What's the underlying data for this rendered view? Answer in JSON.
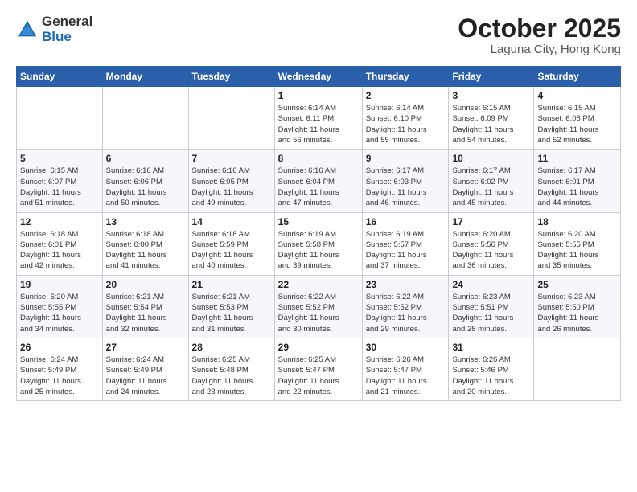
{
  "header": {
    "logo_general": "General",
    "logo_blue": "Blue",
    "month_title": "October 2025",
    "subtitle": "Laguna City, Hong Kong"
  },
  "days_of_week": [
    "Sunday",
    "Monday",
    "Tuesday",
    "Wednesday",
    "Thursday",
    "Friday",
    "Saturday"
  ],
  "weeks": [
    [
      {
        "day": "",
        "info": ""
      },
      {
        "day": "",
        "info": ""
      },
      {
        "day": "",
        "info": ""
      },
      {
        "day": "1",
        "info": "Sunrise: 6:14 AM\nSunset: 6:11 PM\nDaylight: 11 hours\nand 56 minutes."
      },
      {
        "day": "2",
        "info": "Sunrise: 6:14 AM\nSunset: 6:10 PM\nDaylight: 11 hours\nand 55 minutes."
      },
      {
        "day": "3",
        "info": "Sunrise: 6:15 AM\nSunset: 6:09 PM\nDaylight: 11 hours\nand 54 minutes."
      },
      {
        "day": "4",
        "info": "Sunrise: 6:15 AM\nSunset: 6:08 PM\nDaylight: 11 hours\nand 52 minutes."
      }
    ],
    [
      {
        "day": "5",
        "info": "Sunrise: 6:15 AM\nSunset: 6:07 PM\nDaylight: 11 hours\nand 51 minutes."
      },
      {
        "day": "6",
        "info": "Sunrise: 6:16 AM\nSunset: 6:06 PM\nDaylight: 11 hours\nand 50 minutes."
      },
      {
        "day": "7",
        "info": "Sunrise: 6:16 AM\nSunset: 6:05 PM\nDaylight: 11 hours\nand 49 minutes."
      },
      {
        "day": "8",
        "info": "Sunrise: 6:16 AM\nSunset: 6:04 PM\nDaylight: 11 hours\nand 47 minutes."
      },
      {
        "day": "9",
        "info": "Sunrise: 6:17 AM\nSunset: 6:03 PM\nDaylight: 11 hours\nand 46 minutes."
      },
      {
        "day": "10",
        "info": "Sunrise: 6:17 AM\nSunset: 6:02 PM\nDaylight: 11 hours\nand 45 minutes."
      },
      {
        "day": "11",
        "info": "Sunrise: 6:17 AM\nSunset: 6:01 PM\nDaylight: 11 hours\nand 44 minutes."
      }
    ],
    [
      {
        "day": "12",
        "info": "Sunrise: 6:18 AM\nSunset: 6:01 PM\nDaylight: 11 hours\nand 42 minutes."
      },
      {
        "day": "13",
        "info": "Sunrise: 6:18 AM\nSunset: 6:00 PM\nDaylight: 11 hours\nand 41 minutes."
      },
      {
        "day": "14",
        "info": "Sunrise: 6:18 AM\nSunset: 5:59 PM\nDaylight: 11 hours\nand 40 minutes."
      },
      {
        "day": "15",
        "info": "Sunrise: 6:19 AM\nSunset: 5:58 PM\nDaylight: 11 hours\nand 39 minutes."
      },
      {
        "day": "16",
        "info": "Sunrise: 6:19 AM\nSunset: 5:57 PM\nDaylight: 11 hours\nand 37 minutes."
      },
      {
        "day": "17",
        "info": "Sunrise: 6:20 AM\nSunset: 5:56 PM\nDaylight: 11 hours\nand 36 minutes."
      },
      {
        "day": "18",
        "info": "Sunrise: 6:20 AM\nSunset: 5:55 PM\nDaylight: 11 hours\nand 35 minutes."
      }
    ],
    [
      {
        "day": "19",
        "info": "Sunrise: 6:20 AM\nSunset: 5:55 PM\nDaylight: 11 hours\nand 34 minutes."
      },
      {
        "day": "20",
        "info": "Sunrise: 6:21 AM\nSunset: 5:54 PM\nDaylight: 11 hours\nand 32 minutes."
      },
      {
        "day": "21",
        "info": "Sunrise: 6:21 AM\nSunset: 5:53 PM\nDaylight: 11 hours\nand 31 minutes."
      },
      {
        "day": "22",
        "info": "Sunrise: 6:22 AM\nSunset: 5:52 PM\nDaylight: 11 hours\nand 30 minutes."
      },
      {
        "day": "23",
        "info": "Sunrise: 6:22 AM\nSunset: 5:52 PM\nDaylight: 11 hours\nand 29 minutes."
      },
      {
        "day": "24",
        "info": "Sunrise: 6:23 AM\nSunset: 5:51 PM\nDaylight: 11 hours\nand 28 minutes."
      },
      {
        "day": "25",
        "info": "Sunrise: 6:23 AM\nSunset: 5:50 PM\nDaylight: 11 hours\nand 26 minutes."
      }
    ],
    [
      {
        "day": "26",
        "info": "Sunrise: 6:24 AM\nSunset: 5:49 PM\nDaylight: 11 hours\nand 25 minutes."
      },
      {
        "day": "27",
        "info": "Sunrise: 6:24 AM\nSunset: 5:49 PM\nDaylight: 11 hours\nand 24 minutes."
      },
      {
        "day": "28",
        "info": "Sunrise: 6:25 AM\nSunset: 5:48 PM\nDaylight: 11 hours\nand 23 minutes."
      },
      {
        "day": "29",
        "info": "Sunrise: 6:25 AM\nSunset: 5:47 PM\nDaylight: 11 hours\nand 22 minutes."
      },
      {
        "day": "30",
        "info": "Sunrise: 6:26 AM\nSunset: 5:47 PM\nDaylight: 11 hours\nand 21 minutes."
      },
      {
        "day": "31",
        "info": "Sunrise: 6:26 AM\nSunset: 5:46 PM\nDaylight: 11 hours\nand 20 minutes."
      },
      {
        "day": "",
        "info": ""
      }
    ]
  ]
}
